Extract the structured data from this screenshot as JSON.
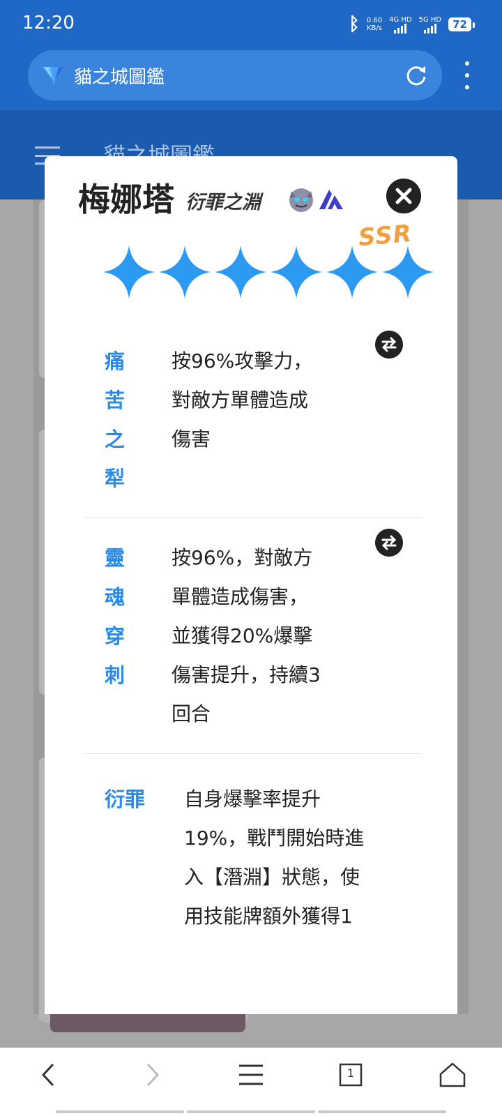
{
  "status_bar": {
    "time": "12:20",
    "network_speed_value": "0.60",
    "network_speed_unit": "KB/s",
    "sim1_label": "4G HD",
    "sim2_label": "5G HD",
    "battery": "72"
  },
  "browser": {
    "url_title": "貓之城圖鑑"
  },
  "page": {
    "header_title": "貓之城圖鑑"
  },
  "character": {
    "name": "梅娜塔",
    "subtitle": "衍罪之淵",
    "rarity": "SSR",
    "stars": 6,
    "faction_icon": "demon-face-icon",
    "class_icon": "class-emblem-icon"
  },
  "skills": [
    {
      "name_chars": [
        "痛",
        "苦",
        "之",
        "犁"
      ],
      "desc_lines": [
        "按96%攻擊力，",
        "對敵方單體造成",
        "傷害"
      ]
    },
    {
      "name_chars": [
        "靈",
        "魂",
        "穿",
        "刺"
      ],
      "desc_lines": [
        "按96%，對敵方",
        "單體造成傷害，",
        "並獲得20%爆擊",
        "傷害提升，持續3",
        "回合"
      ]
    }
  ],
  "trait": {
    "name": "衍罪",
    "desc_lines": [
      "自身爆擊率提升",
      "19%，戰鬥開始時進",
      "入【潛淵】狀態，使",
      "用技能牌額外獲得1"
    ]
  },
  "bottom_nav": {
    "tab_count": "1"
  },
  "colors": {
    "primary": "#1f68c6",
    "accent_blue": "#2a8ae6",
    "star_blue": "#2b9af0",
    "rarity_gold": "#f0a040"
  }
}
